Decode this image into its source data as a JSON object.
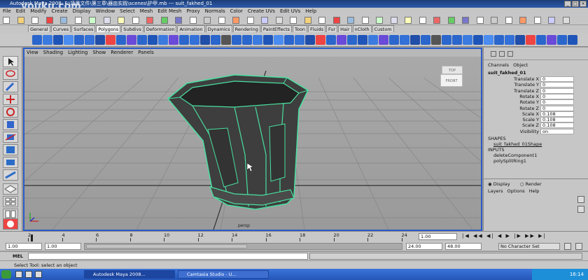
{
  "window": {
    "title": "Autodesk Maya 2008: F:\\场景文件\\第三章\\器皿实践\\scenes\\护甲.mb  ---  suit_fakhed_01"
  },
  "menubar": [
    "File",
    "Edit",
    "Modify",
    "Create",
    "Display",
    "Window",
    "Select",
    "Mesh",
    "Edit Mesh",
    "Proxy",
    "Normals",
    "Color",
    "Create UVs",
    "Edit UVs",
    "Help"
  ],
  "shelf_tabs": [
    "General",
    "Curves",
    "Surfaces",
    "Polygons",
    "Subdivs",
    "Deformation",
    "Animation",
    "Dynamics",
    "Rendering",
    "PaintEffects",
    "Toon",
    "Fluids",
    "Fur",
    "Hair",
    "nCloth",
    "Custom"
  ],
  "shelf_active": "Polygons",
  "viewport": {
    "menu": [
      "View",
      "Shading",
      "Lighting",
      "Show",
      "Renderer",
      "Panels"
    ],
    "camera_label": "persp",
    "viewcube_top": "TOP",
    "viewcube_front": "FRONT"
  },
  "channel_box": {
    "header": [
      "Channels",
      "Object"
    ],
    "object_name": "suit_fakhed_01",
    "attributes": [
      {
        "name": "Translate X",
        "value": "0"
      },
      {
        "name": "Translate Y",
        "value": "0"
      },
      {
        "name": "Translate Z",
        "value": "0"
      },
      {
        "name": "Rotate X",
        "value": "0"
      },
      {
        "name": "Rotate Y",
        "value": "0"
      },
      {
        "name": "Rotate Z",
        "value": "0"
      },
      {
        "name": "Scale X",
        "value": "0.108"
      },
      {
        "name": "Scale Y",
        "value": "0.108"
      },
      {
        "name": "Scale Z",
        "value": "0.108"
      },
      {
        "name": "Visibility",
        "value": "on"
      }
    ],
    "shapes_label": "SHAPES",
    "shape_name": "suit_fakhed_01Shape",
    "inputs_label": "INPUTS",
    "inputs": [
      "deleteComponent1",
      "polySplitRing1"
    ]
  },
  "layer_editor": {
    "display_label": "Display",
    "render_label": "Render",
    "menu": [
      "Layers",
      "Options",
      "Help"
    ]
  },
  "timeline": {
    "ticks": [
      "2",
      "4",
      "6",
      "8",
      "10",
      "12",
      "14",
      "16",
      "18",
      "20",
      "22",
      "24"
    ],
    "current_frame": "1.00"
  },
  "range": {
    "start": "1.00",
    "start2": "1.00",
    "end": "24.00",
    "end2": "48.00",
    "char_set": "No Character Set"
  },
  "command_line": {
    "label": "MEL"
  },
  "help_line": "Select Tool: select an object",
  "taskbar": {
    "items": [
      "Autodesk Maya 2008...",
      "Camtasia Studio - U..."
    ],
    "clock": "16:14"
  },
  "watermark": "youku.com"
}
